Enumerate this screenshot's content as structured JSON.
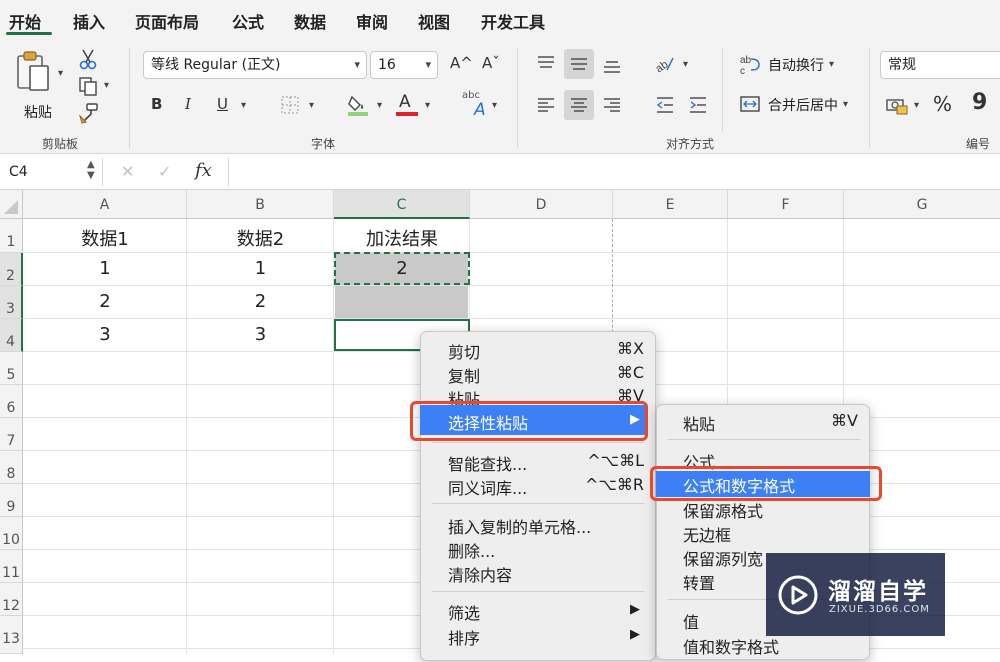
{
  "tabs": [
    "开始",
    "插入",
    "页面布局",
    "公式",
    "数据",
    "审阅",
    "视图",
    "开发工具"
  ],
  "ribbon": {
    "clipboard": {
      "paste_label": "粘贴",
      "group_label": "剪贴板"
    },
    "font": {
      "family": "等线 Regular (正文)",
      "size": "16",
      "grow": "A^",
      "shrink": "Aˇ",
      "bold": "B",
      "italic": "I",
      "underline": "U",
      "group_label": "字体",
      "font_color": "#e0202a"
    },
    "alignment": {
      "wrap_label": "自动换行",
      "merge_label": "合并后居中",
      "group_label": "对齐方式"
    },
    "number": {
      "format": "常规",
      "percent": "%",
      "comma": "9",
      "group_label": "编号"
    }
  },
  "formula_bar": {
    "name_box": "C4",
    "cancel": "✕",
    "enter": "✓",
    "fx": "fx"
  },
  "columns": [
    "A",
    "B",
    "C",
    "D",
    "E",
    "F",
    "G"
  ],
  "rows": [
    "1",
    "2",
    "3",
    "4",
    "5",
    "6",
    "7",
    "8",
    "9",
    "10",
    "11",
    "12",
    "13"
  ],
  "cells": {
    "A1": "数据1",
    "B1": "数据2",
    "C1": "加法结果",
    "A2": "1",
    "B2": "1",
    "C2": "2",
    "A3": "2",
    "B3": "2",
    "A4": "3",
    "B4": "3"
  },
  "context_menu": {
    "cut": "剪切",
    "cut_sc": "⌘X",
    "copy": "复制",
    "copy_sc": "⌘C",
    "paste": "粘贴",
    "paste_sc": "⌘V",
    "paste_special": "选择性粘贴",
    "arrow": "▶",
    "smart_lookup": "智能查找...",
    "smart_lookup_sc": "^⌥⌘L",
    "thesaurus": "同义词库...",
    "thesaurus_sc": "^⌥⌘R",
    "insert_copied": "插入复制的单元格...",
    "delete": "删除...",
    "clear": "清除内容",
    "filter": "筛选",
    "sort": "排序"
  },
  "submenu": {
    "paste": "粘贴",
    "paste_sc": "⌘V",
    "formula": "公式",
    "formula_number": "公式和数字格式",
    "keep_source": "保留源格式",
    "no_border": "无边框",
    "keep_width": "保留源列宽",
    "transpose": "转置",
    "values": "值",
    "values_number": "值和数字格式"
  },
  "watermark": {
    "brand": "溜溜自学",
    "url": "ZIXUE.3D66.COM"
  },
  "colors": {
    "accent": "#217346",
    "highlight": "#3d80f6",
    "callout": "#e8492e",
    "selection_fill": "#c9c9c9"
  }
}
